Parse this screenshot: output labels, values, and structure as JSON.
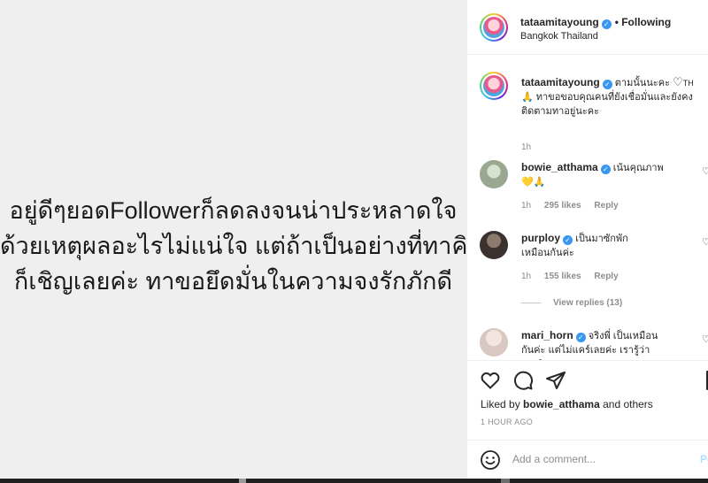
{
  "post": {
    "caption_lines": [
      "อยู่ดีๆยอดFollowerก็ลดลงจนน่าประหลาดใจ",
      "ด้วยเหตุผลอะไรไม่แน่ใจ แต่ถ้าเป็นอย่างที่ทาคิด",
      "ก็เชิญเลยค่ะ ทาขอยึดมั่นในความจงรักภักดี"
    ]
  },
  "header": {
    "username": "tataamitayoung",
    "follow_label": "• Following",
    "location": "Bangkok Thailand"
  },
  "caption": {
    "username": "tataamitayoung",
    "text_line1": "ตามนั้นนะคะ",
    "heart": "♡",
    "th_tag": "TH",
    "text_line2": "🙏 ทาขอขอบคุณคนที่ยังเชื่อมั่นและยังคง",
    "text_line3": "ติดตามทาอยู่นะคะ",
    "time": "1h"
  },
  "comments": [
    {
      "username": "bowie_atthama",
      "text": "เน้นคุณภาพ",
      "emoji": "💛🙏",
      "time": "1h",
      "likes": "295 likes",
      "reply": "Reply"
    },
    {
      "username": "purploy",
      "text": "เป็นมาซักพักเหมือนกันค่ะ",
      "time": "1h",
      "likes": "155 likes",
      "reply": "Reply",
      "view_replies": "View replies (13)"
    },
    {
      "username": "mari_horn",
      "text": "จริงพี่ เป็นเหมือนกันค่ะ แต่ไม่แคร์เลยค่ะ เรารู้ว่าเราทำ"
    }
  ],
  "actions": {
    "liked_by_prefix": "Liked by",
    "liked_by_user": "bowie_atthama",
    "liked_by_suffix": "and others",
    "timestamp": "1 HOUR AGO"
  },
  "add_comment": {
    "placeholder": "Add a comment...",
    "post_label": "Po"
  }
}
